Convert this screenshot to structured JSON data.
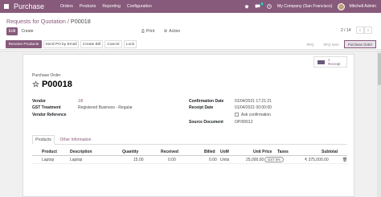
{
  "navbar": {
    "brand": "Purchase",
    "menu": [
      "Orders",
      "Products",
      "Reporting",
      "Configuration"
    ],
    "badge": "5",
    "company": "My Company (San Francisco)",
    "user": "Mitchell Admin",
    "color": "#875a7b"
  },
  "control": {
    "breadcrumb_root": "Requests for Quotation",
    "breadcrumb_sep": " / ",
    "breadcrumb_current": "P00018",
    "edit": "Edit",
    "create": "Create",
    "print": "Print",
    "action": "Action",
    "pager": "2 / 14"
  },
  "statusbar": {
    "buttons": [
      "Receive Products",
      "Send PO by Email",
      "Create Bill",
      "Cancel",
      "Lock"
    ],
    "stages": [
      "RFQ",
      "RFQ Sent",
      "Purchase Order"
    ],
    "current_stage": "Purchase Order"
  },
  "receipt": {
    "count": "1",
    "label": "Receipt"
  },
  "form": {
    "doc_type": "Purchase Order",
    "name": "P00018",
    "left": [
      {
        "label": "Vendor",
        "value": "Jill"
      },
      {
        "label": "GST Treatment",
        "value": "Registered Business - Regular"
      },
      {
        "label": "Vendor Reference",
        "value": ""
      }
    ],
    "right": [
      {
        "label": "Confirmation Date",
        "value": "01/04/2021 17:21:21"
      },
      {
        "label": "Receipt Date",
        "value": "01/04/2021 00:00:00"
      },
      {
        "label": "",
        "value": "Ask confirmation"
      },
      {
        "label": "Source Document",
        "value": "OP/00012"
      }
    ]
  },
  "tabs": [
    "Products",
    "Other Information"
  ],
  "table": {
    "headers": [
      "Product",
      "Description",
      "Quantity",
      "Received",
      "Billed",
      "UoM",
      "Unit Price",
      "Taxes",
      "Subtotal"
    ],
    "rows": [
      {
        "product": "Laptop",
        "description": "Laptop",
        "quantity": "15.00",
        "received": "0.00",
        "billed": "0.00",
        "uom": "Units",
        "unit_price": "25,000.00",
        "taxes": "GST 5%",
        "subtotal": "₹ 375,000.00"
      }
    ]
  }
}
